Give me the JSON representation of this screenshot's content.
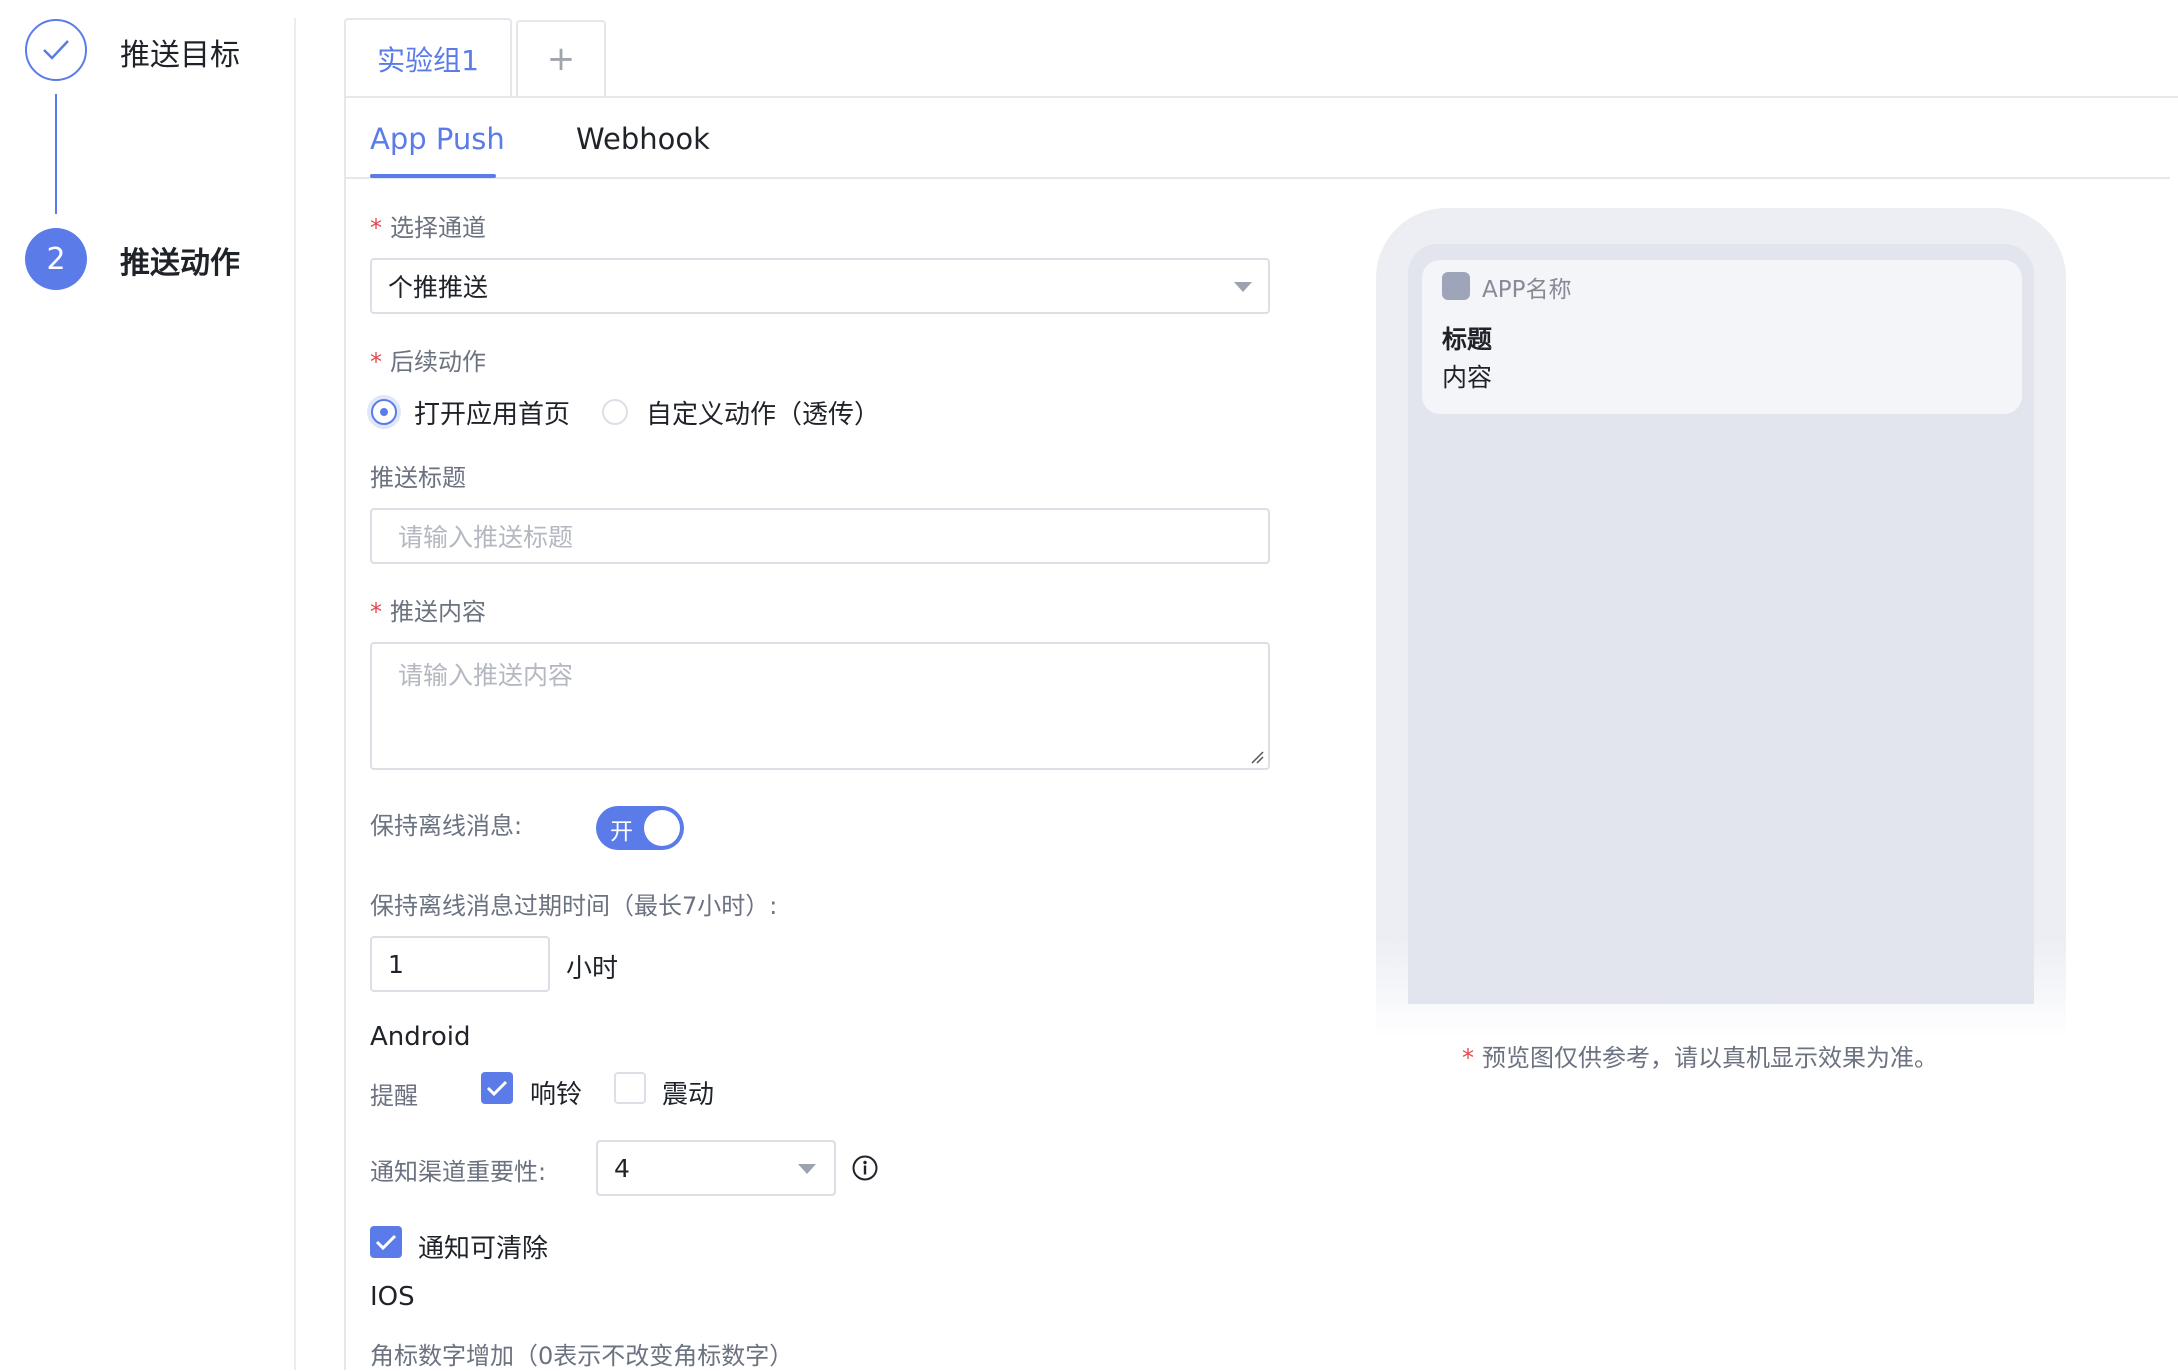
{
  "steps": [
    {
      "label": "推送目标",
      "status": "done"
    },
    {
      "number": "2",
      "label": "推送动作",
      "status": "current"
    }
  ],
  "groupTabs": {
    "active": "实验组1",
    "add": "+"
  },
  "channelTabs": [
    "App Push",
    "Webhook"
  ],
  "form": {
    "channel": {
      "required": "*",
      "label": "选择通道",
      "value": "个推推送"
    },
    "followAction": {
      "required": "*",
      "label": "后续动作",
      "options": [
        "打开应用首页",
        "自定义动作（透传）"
      ],
      "selected": "打开应用首页"
    },
    "pushTitle": {
      "label": "推送标题",
      "placeholder": "请输入推送标题"
    },
    "pushContent": {
      "required": "*",
      "label": "推送内容",
      "placeholder": "请输入推送内容"
    },
    "keepOffline": {
      "label": "保持离线消息:",
      "switchText": "开",
      "on": true
    },
    "offlineExpire": {
      "label": "保持离线消息过期时间（最长7小时）:",
      "value": "1",
      "unit": "小时"
    },
    "android": {
      "title": "Android",
      "remindLabel": "提醒",
      "ring": {
        "label": "响铃",
        "checked": true
      },
      "vibrate": {
        "label": "震动",
        "checked": false
      },
      "importance": {
        "label": "通知渠道重要性:",
        "value": "4"
      },
      "clearable": {
        "label": "通知可清除",
        "checked": true
      }
    },
    "ios": {
      "title": "IOS",
      "badgeLabel": "角标数字增加（0表示不改变角标数字）"
    }
  },
  "preview": {
    "appName": "APP名称",
    "title": "标题",
    "content": "内容",
    "noteStar": "*",
    "note": "预览图仅供参考，请以真机显示效果为准。"
  },
  "colors": {
    "accent": "#5b7ce8",
    "required": "#e5484d"
  }
}
